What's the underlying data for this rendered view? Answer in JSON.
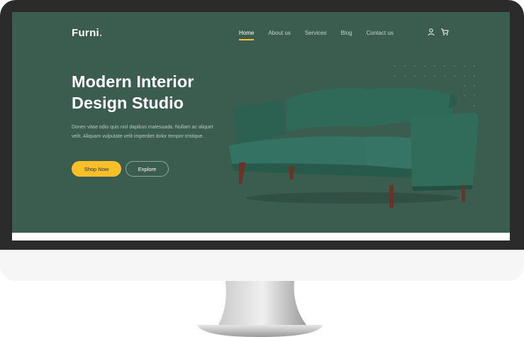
{
  "site": {
    "logo_text": "Furni",
    "logo_dot": "."
  },
  "nav": {
    "items": [
      {
        "label": "Home",
        "active": true
      },
      {
        "label": "About us",
        "active": false
      },
      {
        "label": "Services",
        "active": false
      },
      {
        "label": "Blog",
        "active": false
      },
      {
        "label": "Contact us",
        "active": false
      }
    ],
    "icons": [
      "user-icon",
      "cart-icon"
    ]
  },
  "hero": {
    "title_line1": "Modern Interior",
    "title_line2": "Design Studio",
    "description": "Donec vitae odio quis nisl dapibus malesuada. Nullam ac aliquet velit. Aliquam vulputate velit imperdiet dolor tempor tristique.",
    "primary_button": "Shop Now",
    "secondary_button": "Explore",
    "image": "green-velvet-sofa"
  },
  "colors": {
    "hero_bg": "#3b5d50",
    "accent": "#f9bf29",
    "bezel": "#2b2b2b"
  }
}
